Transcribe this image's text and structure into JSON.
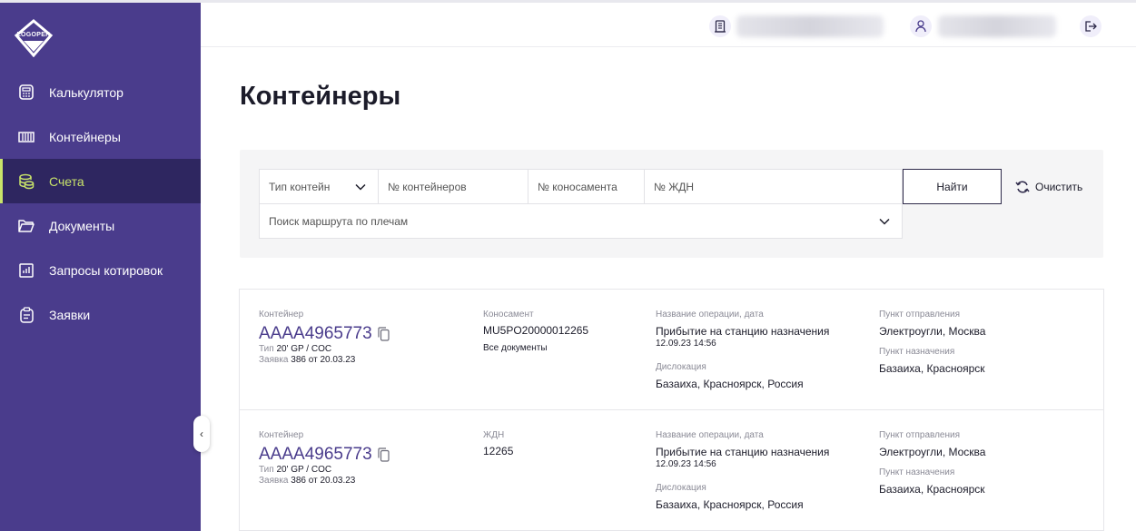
{
  "logo": {
    "text": "LOGOPER"
  },
  "sidebar": {
    "items": [
      {
        "label": "Калькулятор",
        "icon": "calculator-icon",
        "active": false
      },
      {
        "label": "Контейнеры",
        "icon": "container-icon",
        "active": false
      },
      {
        "label": "Счета",
        "icon": "coins-icon",
        "active": true
      },
      {
        "label": "Документы",
        "icon": "folder-icon",
        "active": false
      },
      {
        "label": "Запросы котировок",
        "icon": "chart-icon",
        "active": false
      },
      {
        "label": "Заявки",
        "icon": "clipboard-icon",
        "active": false
      }
    ]
  },
  "topbar": {
    "company_icon": "building-icon",
    "user_icon": "user-icon",
    "logout_icon": "logout-icon"
  },
  "page": {
    "title": "Контейнеры"
  },
  "filters": {
    "type_select": "Тип контейн",
    "containers_placeholder": "№ контейнеров",
    "bill_placeholder": "№ коносамента",
    "rail_placeholder": "№ ЖДН",
    "route_select": "Поиск маршрута по плечам",
    "find_label": "Найти",
    "clear_label": "Очистить"
  },
  "cards": [
    {
      "container_label": "Контейнер",
      "container_number": "AAAA4965773",
      "type_label": "Тип",
      "type_value": "20' GP / COC",
      "order_label": "Заявка",
      "order_value": "386 от 20.03.23",
      "doc_label": "Коносамент",
      "doc_value": "MU5PO20000012265",
      "docs_link": "Все документы",
      "operation_label": "Название операции, дата",
      "operation_value": "Прибытие на станцию назначения",
      "operation_date": "12.09.23  14:56",
      "location_label": "Дислокация",
      "location_value": "Базаиха, Красноярск, Россия",
      "origin_label": "Пункт отправления",
      "origin_value": "Электроугли, Москва",
      "dest_label": "Пункт назначения",
      "dest_value": "Базаиха, Красноярск"
    },
    {
      "container_label": "Контейнер",
      "container_number": "AAAA4965773",
      "type_label": "Тип",
      "type_value": "20' GP / COC",
      "order_label": "Заявка",
      "order_value": "386 от 20.03.23",
      "doc_label": "ЖДН",
      "doc_value": "12265",
      "operation_label": "Название операции, дата",
      "operation_value": "Прибытие на станцию назначения",
      "operation_date": "12.09.23  14:56",
      "location_label": "Дислокация",
      "location_value": "Базаиха, Красноярск, Россия",
      "origin_label": "Пункт отправления",
      "origin_value": "Электроугли, Москва",
      "dest_label": "Пункт назначения",
      "dest_value": "Базаиха, Красноярск"
    }
  ],
  "colors": {
    "sidebar": "#4a3c8c",
    "sidebar_active": "#2e2660",
    "accent": "#c8e36a",
    "container_number": "#4a3c8c"
  }
}
